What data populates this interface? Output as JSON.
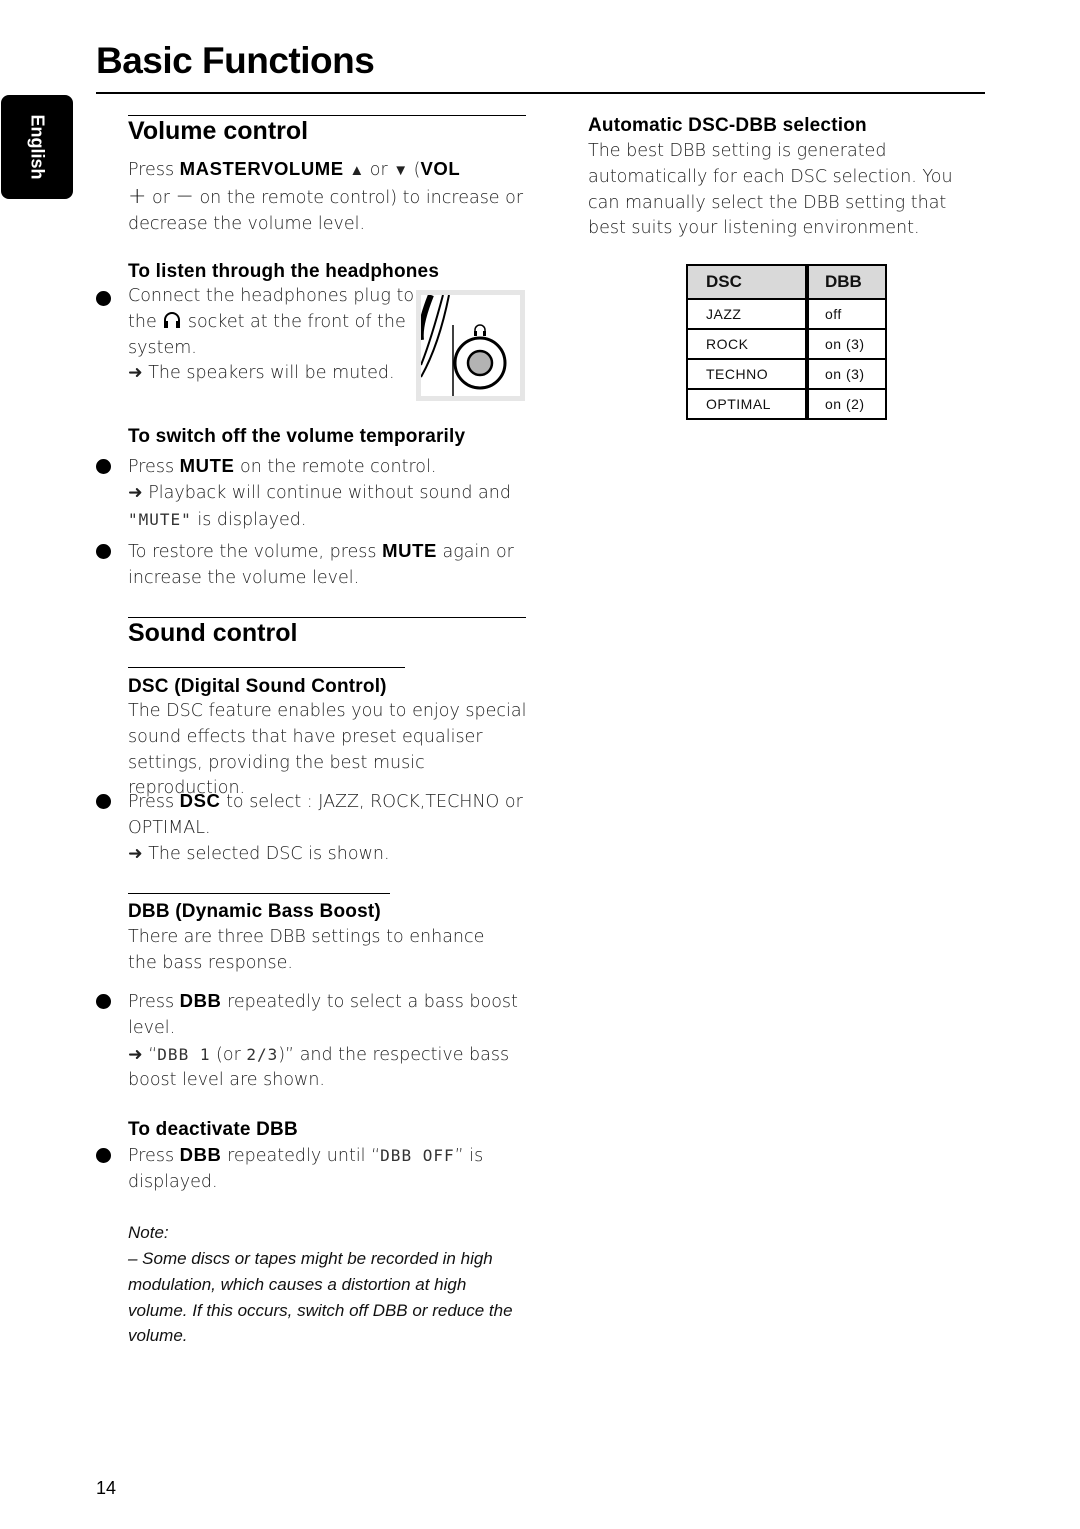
{
  "page": {
    "title": "Basic Functions",
    "language_tab": "English",
    "page_number": "14"
  },
  "volume_control": {
    "heading": "Volume control",
    "intro": {
      "press": "Press ",
      "master_volume": "MASTERVOLUME",
      "up_symbol": "▲",
      "or1": " or ",
      "down_symbol": "▼",
      "paren_open": " (",
      "vol": "VOL",
      "plus": "+",
      "or2": " or ",
      "minus": "−",
      "rest": " on the remote control) to increase or decrease the volume level."
    },
    "headphones": {
      "heading": "To listen through the headphones",
      "line1": "Connect the headphones plug to",
      "line2a": "the ",
      "line2b": " socket at the front of the",
      "line3": "system.",
      "result": "➜ The speakers will be muted.",
      "figure_icon": "headphone-socket-illustration"
    },
    "mute": {
      "heading": "To switch off the volume temporarily",
      "bullet1_press": "Press ",
      "bullet1_key": "MUTE",
      "bullet1_rest": " on the remote control.",
      "result_line1": "➜ Playback will continue without sound and",
      "result_lcd": "\"MUTE\"",
      "result_line2_rest": " is displayed.",
      "bullet2_a": "To restore the volume, press ",
      "bullet2_key": "MUTE",
      "bullet2_b": " again or increase the volume level."
    }
  },
  "sound_control": {
    "heading": "Sound control",
    "dsc": {
      "heading": "DSC (Digital Sound Control)",
      "description": "The DSC feature enables you to enjoy special sound effects that have preset equaliser settings, providing the best music reproduction.",
      "bullet_press": "Press ",
      "bullet_key": "DSC",
      "bullet_rest": " to select : JAZZ, ROCK,TECHNO or OPTIMAL.",
      "result": "➜ The selected DSC is shown."
    },
    "dbb": {
      "heading": "DBB (Dynamic Bass Boost)",
      "description": "There are three DBB settings to enhance the bass response.",
      "bullet_press": "Press ",
      "bullet_key": "DBB",
      "bullet_rest": " repeatedly to select a bass boost level.",
      "result_arrow": "➜ “",
      "result_lcd1": "DBB 1",
      "result_mid": " (or ",
      "result_lcd2": "2/3",
      "result_rest": ")” and the respective bass boost level are shown."
    },
    "deactivate": {
      "heading": "To deactivate DBB",
      "bullet_press": "Press ",
      "bullet_key": "DBB",
      "bullet_mid": " repeatedly until “",
      "bullet_lcd": "DBB OFF",
      "bullet_rest": "” is displayed."
    },
    "note": {
      "label": "Note:",
      "text": "–  Some discs or tapes might be recorded in high modulation, which causes a distortion at high volume. If this occurs, switch off DBB or reduce the volume."
    }
  },
  "auto_selection": {
    "heading": "Automatic DSC-DBB selection",
    "description": "The best DBB setting is generated automatically for each DSC selection. You can manually select the DBB setting that best suits your listening environment.",
    "table": {
      "headers": [
        "DSC",
        "DBB"
      ],
      "rows": [
        [
          "JAZZ",
          "off"
        ],
        [
          "ROCK",
          "on (3)"
        ],
        [
          "TECHNO",
          "on (3)"
        ],
        [
          "OPTIMAL",
          "on (2)"
        ]
      ]
    }
  }
}
